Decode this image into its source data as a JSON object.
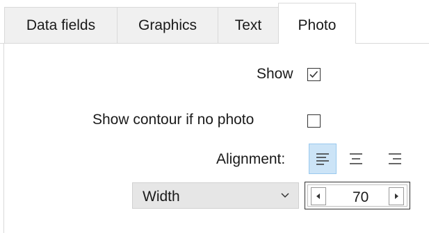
{
  "tabs": [
    {
      "label": "Data fields"
    },
    {
      "label": "Graphics"
    },
    {
      "label": "Text"
    },
    {
      "label": "Photo",
      "active": true
    }
  ],
  "photo": {
    "show_label": "Show",
    "show_checked": true,
    "contour_label": "Show contour if no photo",
    "contour_checked": false,
    "alignment_label": "Alignment:",
    "alignment_options": [
      "left-align-icon",
      "center-align-icon",
      "right-align-icon"
    ],
    "alignment_selected": "left-align-icon",
    "size_mode": "Width",
    "size_value": "70"
  },
  "colors": {
    "selected_bg": "#cce4f7",
    "selected_border": "#99c9ef",
    "tab_bg": "#f0f0f0"
  }
}
